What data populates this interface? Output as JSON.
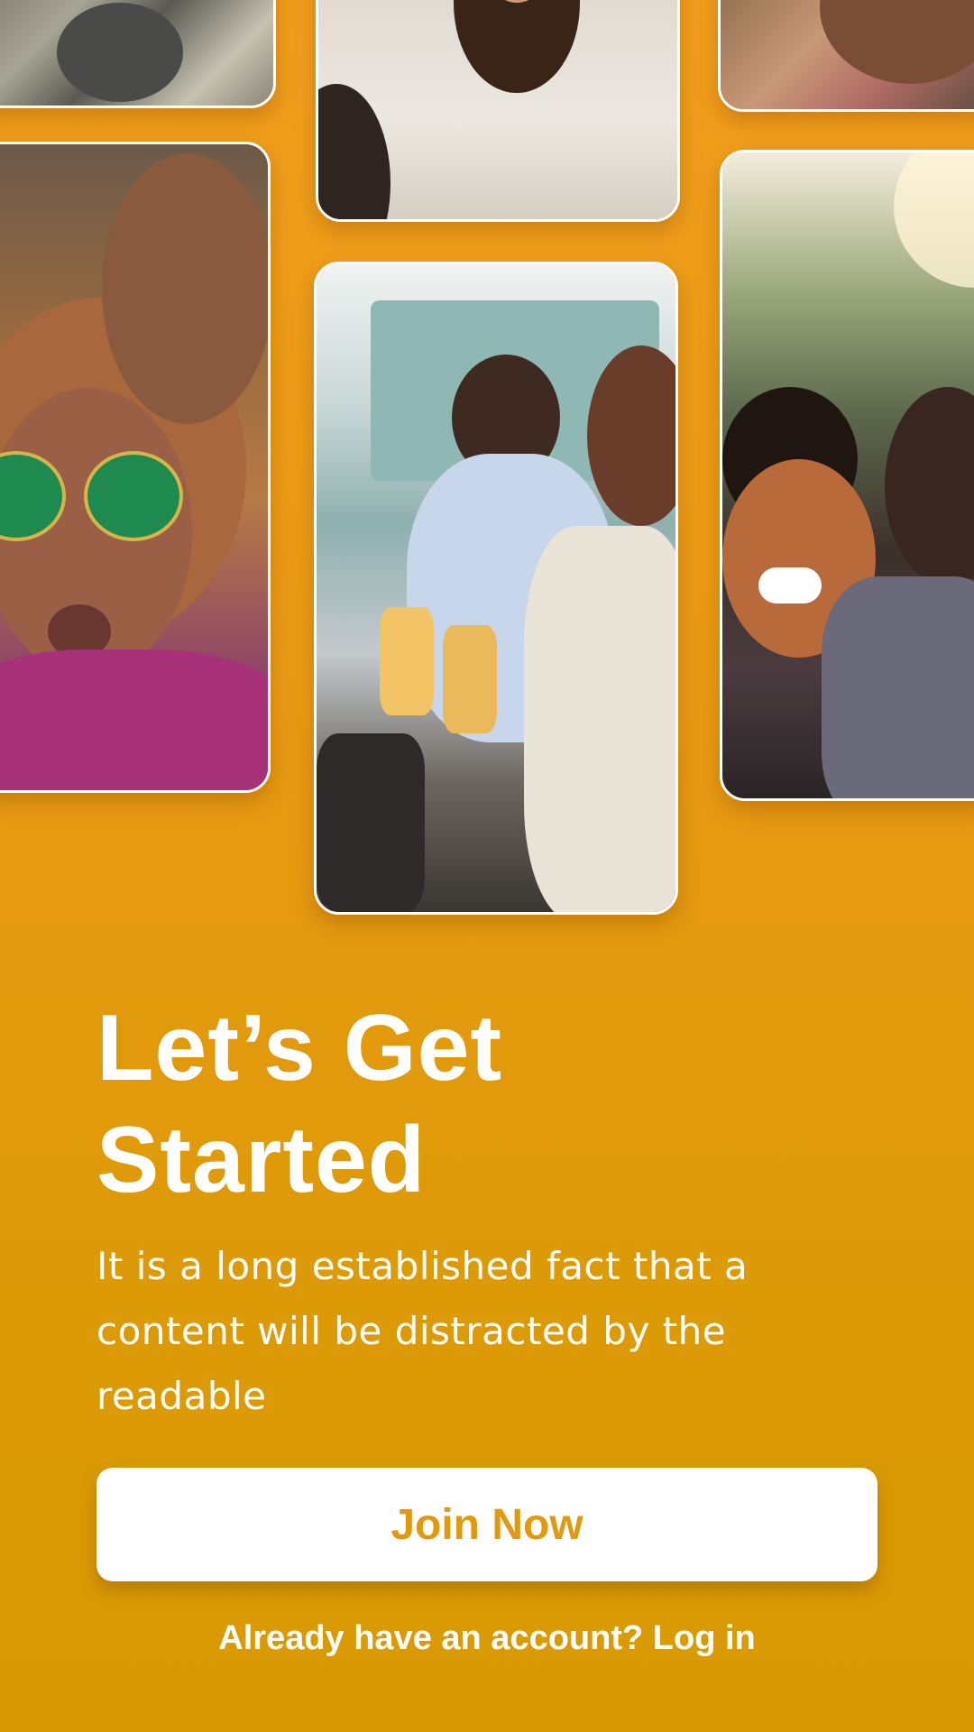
{
  "onboarding": {
    "headline": "Let’s Get Started",
    "description": "It is a long established fact that a content will be distracted by the readable",
    "primary_button_label": "Join Now",
    "login_prompt": "Already have an account?",
    "login_link_label": "Log in"
  },
  "colors": {
    "background_top": "#F19E1D",
    "background_bottom": "#D89A03",
    "button_background": "#FFFFFF",
    "button_text": "#E19A10",
    "text": "#FFFFFF"
  }
}
